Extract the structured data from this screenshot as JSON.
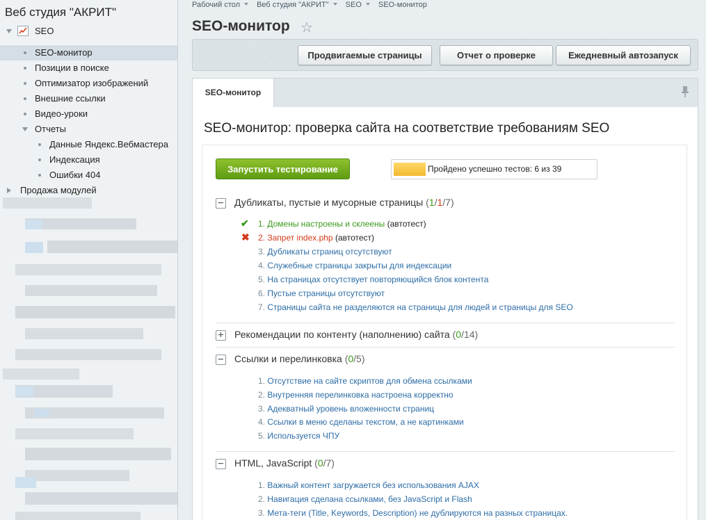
{
  "sidebar": {
    "site_title": "Веб студия \"АКРИТ\"",
    "seo_label": "SEO",
    "items": [
      {
        "label": "SEO-монитор",
        "active": true
      },
      {
        "label": "Позиции в поиске"
      },
      {
        "label": "Оптимизатор изображений"
      },
      {
        "label": "Внешние ссылки"
      },
      {
        "label": "Видео-уроки"
      }
    ],
    "reports_label": "Отчеты",
    "reports_items": [
      "Данные Яндекс.Вебмастера",
      "Индексация",
      "Ошибки 404"
    ],
    "modules_label": "Продажа модулей"
  },
  "breadcrumb": [
    "Рабочий стол",
    "Веб студия \"АКРИТ\"",
    "SEO",
    "SEO-монитор"
  ],
  "page_title": "SEO-монитор",
  "toolbar": {
    "btn_pages": "Продвигаемые страницы",
    "btn_report": "Отчет о проверке",
    "btn_autorun": "Ежедневный автозапуск"
  },
  "tab_label": "SEO-монитор",
  "heading": "SEO-монитор: проверка сайта на соответствие требованиям SEO",
  "run_button": "Запустить тестирование",
  "progress": {
    "text": "Пройдено успешно тестов: 6 из 39",
    "passed": 6,
    "total": 39
  },
  "sections": [
    {
      "title": "Дубликаты, пустые и мусорные страницы",
      "count_open": "(",
      "count_pass": "1",
      "count_slash1": "/",
      "count_fail": "1",
      "count_rest": "/7)",
      "toggle": "−",
      "items": [
        {
          "num": "1.",
          "text": "Домены настроены и склеены",
          "auto": "(автотест)",
          "status": "pass"
        },
        {
          "num": "2.",
          "text": "Запрет index.php",
          "auto": "(автотест)",
          "status": "fail"
        },
        {
          "num": "3.",
          "text": "Дубликаты страниц отсутствуют"
        },
        {
          "num": "4.",
          "text": "Служебные страницы закрыты для индексации"
        },
        {
          "num": "5.",
          "text": "На страницах отсутствует повторяющийся блок контента"
        },
        {
          "num": "6.",
          "text": "Пустые страницы отсутствуют"
        },
        {
          "num": "7.",
          "text": "Страницы сайта не разделяются на страницы для людей и страницы для SEO"
        }
      ]
    },
    {
      "title": "Рекомендации по контенту (наполнению) сайта",
      "count_open": "(",
      "count_pass": "0",
      "count_rest": "/14)",
      "toggle": "+"
    },
    {
      "title": "Ссылки и перелинковка",
      "count_open": "(",
      "count_pass": "0",
      "count_rest": "/5)",
      "toggle": "−",
      "items": [
        {
          "num": "1.",
          "text": "Отсутствие на сайте скриптов для обмена ссылками"
        },
        {
          "num": "2.",
          "text": "Внутренняя перелинковка настроена корректно"
        },
        {
          "num": "3.",
          "text": "Адекватный уровень вложенности страниц"
        },
        {
          "num": "4.",
          "text": "Ссылки в меню сделаны текстом, а не картинками"
        },
        {
          "num": "5.",
          "text": "Используется ЧПУ"
        }
      ]
    },
    {
      "title": "HTML, JavaScript",
      "count_open": "(",
      "count_pass": "0",
      "count_rest": "/7)",
      "toggle": "−",
      "items": [
        {
          "num": "1.",
          "text": "Важный контент загружается без использования AJAX"
        },
        {
          "num": "2.",
          "text": "Навигация сделана ссылками, без JavaScript и Flash"
        },
        {
          "num": "3.",
          "text": "Мета-теги (Title, Keywords, Description) не дублируются на разных страницах."
        }
      ]
    }
  ],
  "icons": {
    "pass": "✔",
    "fail": "✖",
    "star": "☆"
  },
  "colors": {
    "pass": "#3a9a1a",
    "fail": "#d23a1a",
    "link": "#2d6da6",
    "run_button": "#6aa81b",
    "progress_fill": "#f3b92f"
  }
}
